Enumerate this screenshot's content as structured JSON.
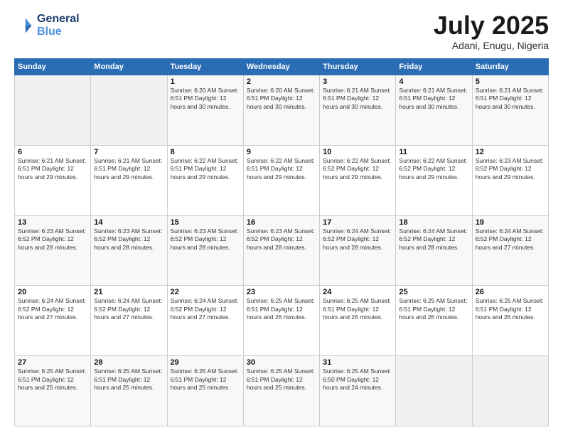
{
  "header": {
    "logo_line1": "General",
    "logo_line2": "Blue",
    "month": "July 2025",
    "location": "Adani, Enugu, Nigeria"
  },
  "days_of_week": [
    "Sunday",
    "Monday",
    "Tuesday",
    "Wednesday",
    "Thursday",
    "Friday",
    "Saturday"
  ],
  "weeks": [
    [
      {
        "day": "",
        "info": ""
      },
      {
        "day": "",
        "info": ""
      },
      {
        "day": "1",
        "info": "Sunrise: 6:20 AM\nSunset: 6:51 PM\nDaylight: 12 hours\nand 30 minutes."
      },
      {
        "day": "2",
        "info": "Sunrise: 6:20 AM\nSunset: 6:51 PM\nDaylight: 12 hours\nand 30 minutes."
      },
      {
        "day": "3",
        "info": "Sunrise: 6:21 AM\nSunset: 6:51 PM\nDaylight: 12 hours\nand 30 minutes."
      },
      {
        "day": "4",
        "info": "Sunrise: 6:21 AM\nSunset: 6:51 PM\nDaylight: 12 hours\nand 30 minutes."
      },
      {
        "day": "5",
        "info": "Sunrise: 6:21 AM\nSunset: 6:51 PM\nDaylight: 12 hours\nand 30 minutes."
      }
    ],
    [
      {
        "day": "6",
        "info": "Sunrise: 6:21 AM\nSunset: 6:51 PM\nDaylight: 12 hours\nand 29 minutes."
      },
      {
        "day": "7",
        "info": "Sunrise: 6:21 AM\nSunset: 6:51 PM\nDaylight: 12 hours\nand 29 minutes."
      },
      {
        "day": "8",
        "info": "Sunrise: 6:22 AM\nSunset: 6:51 PM\nDaylight: 12 hours\nand 29 minutes."
      },
      {
        "day": "9",
        "info": "Sunrise: 6:22 AM\nSunset: 6:51 PM\nDaylight: 12 hours\nand 29 minutes."
      },
      {
        "day": "10",
        "info": "Sunrise: 6:22 AM\nSunset: 6:52 PM\nDaylight: 12 hours\nand 29 minutes."
      },
      {
        "day": "11",
        "info": "Sunrise: 6:22 AM\nSunset: 6:52 PM\nDaylight: 12 hours\nand 29 minutes."
      },
      {
        "day": "12",
        "info": "Sunrise: 6:23 AM\nSunset: 6:52 PM\nDaylight: 12 hours\nand 29 minutes."
      }
    ],
    [
      {
        "day": "13",
        "info": "Sunrise: 6:23 AM\nSunset: 6:52 PM\nDaylight: 12 hours\nand 28 minutes."
      },
      {
        "day": "14",
        "info": "Sunrise: 6:23 AM\nSunset: 6:52 PM\nDaylight: 12 hours\nand 28 minutes."
      },
      {
        "day": "15",
        "info": "Sunrise: 6:23 AM\nSunset: 6:52 PM\nDaylight: 12 hours\nand 28 minutes."
      },
      {
        "day": "16",
        "info": "Sunrise: 6:23 AM\nSunset: 6:52 PM\nDaylight: 12 hours\nand 28 minutes."
      },
      {
        "day": "17",
        "info": "Sunrise: 6:24 AM\nSunset: 6:52 PM\nDaylight: 12 hours\nand 28 minutes."
      },
      {
        "day": "18",
        "info": "Sunrise: 6:24 AM\nSunset: 6:52 PM\nDaylight: 12 hours\nand 28 minutes."
      },
      {
        "day": "19",
        "info": "Sunrise: 6:24 AM\nSunset: 6:52 PM\nDaylight: 12 hours\nand 27 minutes."
      }
    ],
    [
      {
        "day": "20",
        "info": "Sunrise: 6:24 AM\nSunset: 6:52 PM\nDaylight: 12 hours\nand 27 minutes."
      },
      {
        "day": "21",
        "info": "Sunrise: 6:24 AM\nSunset: 6:52 PM\nDaylight: 12 hours\nand 27 minutes."
      },
      {
        "day": "22",
        "info": "Sunrise: 6:24 AM\nSunset: 6:52 PM\nDaylight: 12 hours\nand 27 minutes."
      },
      {
        "day": "23",
        "info": "Sunrise: 6:25 AM\nSunset: 6:51 PM\nDaylight: 12 hours\nand 26 minutes."
      },
      {
        "day": "24",
        "info": "Sunrise: 6:25 AM\nSunset: 6:51 PM\nDaylight: 12 hours\nand 26 minutes."
      },
      {
        "day": "25",
        "info": "Sunrise: 6:25 AM\nSunset: 6:51 PM\nDaylight: 12 hours\nand 26 minutes."
      },
      {
        "day": "26",
        "info": "Sunrise: 6:25 AM\nSunset: 6:51 PM\nDaylight: 12 hours\nand 26 minutes."
      }
    ],
    [
      {
        "day": "27",
        "info": "Sunrise: 6:25 AM\nSunset: 6:51 PM\nDaylight: 12 hours\nand 25 minutes."
      },
      {
        "day": "28",
        "info": "Sunrise: 6:25 AM\nSunset: 6:51 PM\nDaylight: 12 hours\nand 25 minutes."
      },
      {
        "day": "29",
        "info": "Sunrise: 6:25 AM\nSunset: 6:51 PM\nDaylight: 12 hours\nand 25 minutes."
      },
      {
        "day": "30",
        "info": "Sunrise: 6:25 AM\nSunset: 6:51 PM\nDaylight: 12 hours\nand 25 minutes."
      },
      {
        "day": "31",
        "info": "Sunrise: 6:25 AM\nSunset: 6:50 PM\nDaylight: 12 hours\nand 24 minutes."
      },
      {
        "day": "",
        "info": ""
      },
      {
        "day": "",
        "info": ""
      }
    ]
  ]
}
